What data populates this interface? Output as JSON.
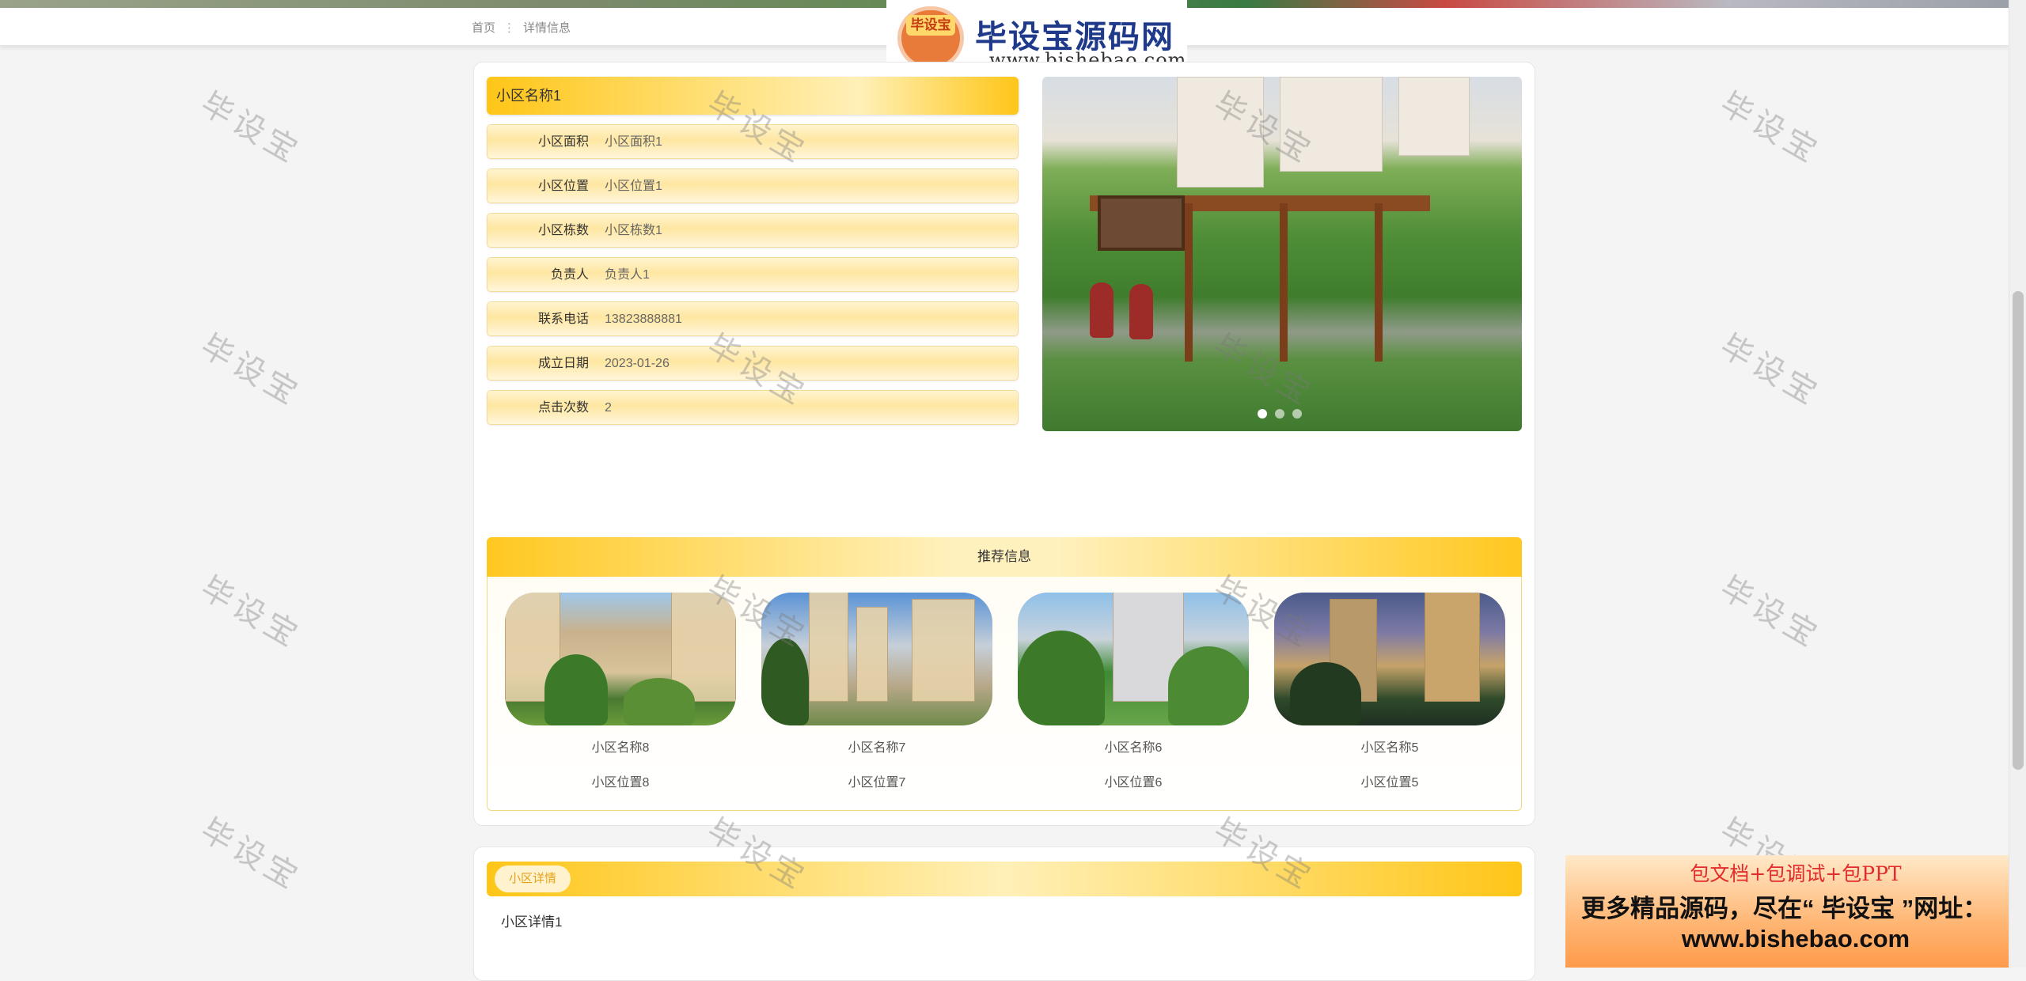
{
  "breadcrumb": {
    "home": "首页",
    "separator": "⋮",
    "current": "详情信息"
  },
  "logo": {
    "badge": "毕设宝",
    "title": "毕设宝源码网",
    "url": "www.bishebao.com"
  },
  "detail": {
    "name": "小区名称1",
    "fields": [
      {
        "label": "小区面积",
        "value": "小区面积1"
      },
      {
        "label": "小区位置",
        "value": "小区位置1"
      },
      {
        "label": "小区栋数",
        "value": "小区栋数1"
      },
      {
        "label": "负责人",
        "value": "负责人1"
      },
      {
        "label": "联系电话",
        "value": "13823888881"
      },
      {
        "label": "成立日期",
        "value": "2023-01-26"
      },
      {
        "label": "点击次数",
        "value": "2"
      }
    ]
  },
  "carousel": {
    "slides": 3,
    "active": 1
  },
  "recommend": {
    "title": "推荐信息",
    "items": [
      {
        "name": "小区名称8",
        "location": "小区位置8"
      },
      {
        "name": "小区名称7",
        "location": "小区位置7"
      },
      {
        "name": "小区名称6",
        "location": "小区位置6"
      },
      {
        "name": "小区名称5",
        "location": "小区位置5"
      }
    ]
  },
  "description": {
    "tab": "小区详情",
    "text": "小区详情1"
  },
  "watermark": "毕设宝",
  "ad": {
    "line1": "包文档+包调试+包PPT",
    "line2": "更多精品源码，尽在“ 毕设宝 ”网址：",
    "line3": "www.bishebao.com"
  },
  "colors": {
    "accent": "#ffc618",
    "accent_light": "#fff0b8",
    "tab_text": "#e6a21a",
    "ad_red": "#e22b2b"
  }
}
